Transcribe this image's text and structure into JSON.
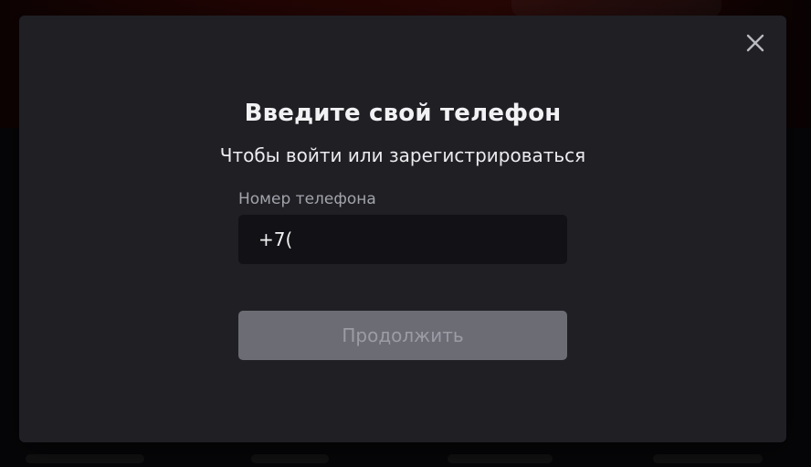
{
  "dialog": {
    "title": "Введите свой телефон",
    "subtitle": "Чтобы войти или зарегистрироваться",
    "phone_field": {
      "label": "Номер телефона",
      "value": "+7("
    },
    "continue_label": "Продолжить",
    "continue_enabled": false,
    "close_icon": "close-icon"
  },
  "colors": {
    "dialog_background": "#1f1f24",
    "input_background": "#121216",
    "button_disabled_background": "#6c6c75",
    "button_disabled_text": "#9c9ca5",
    "title_text": "#f2f2f4",
    "label_text": "#a3a3ac"
  }
}
